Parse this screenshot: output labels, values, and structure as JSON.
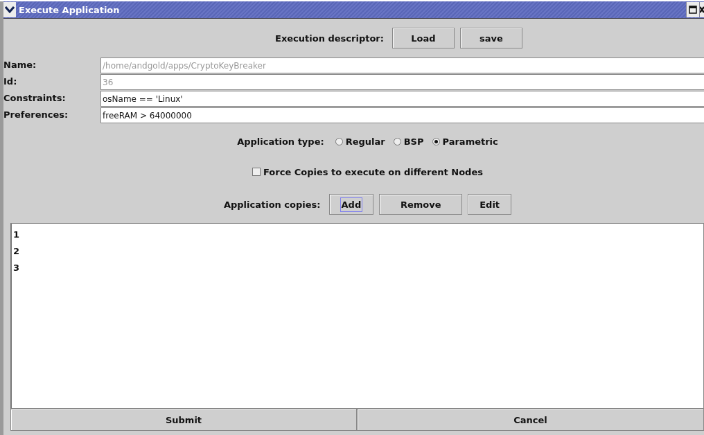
{
  "window": {
    "title": "Execute Application"
  },
  "descriptor": {
    "label": "Execution descriptor:",
    "buttons": [
      {
        "label": "Load"
      },
      {
        "label": "save"
      }
    ]
  },
  "fields": [
    {
      "label": "Name:",
      "value": "/home/andgold/apps/CryptoKeyBreaker",
      "disabled": true
    },
    {
      "label": "Id:",
      "value": "36",
      "disabled": true
    },
    {
      "label": "Constraints:",
      "value": "osName == 'Linux'",
      "disabled": false
    },
    {
      "label": "Preferences:",
      "value": "freeRAM > 64000000",
      "disabled": false
    }
  ],
  "application_type": {
    "label": "Application type:",
    "options": [
      {
        "label": "Regular",
        "selected": false
      },
      {
        "label": "BSP",
        "selected": false
      },
      {
        "label": "Parametric",
        "selected": true
      }
    ]
  },
  "force_copies": {
    "label": "Force Copies to execute on different Nodes",
    "checked": false
  },
  "copies": {
    "label": "Application copies:",
    "buttons": [
      {
        "label": "Add",
        "focused": true
      },
      {
        "label": "Remove",
        "focused": false
      },
      {
        "label": "Edit",
        "focused": false
      }
    ]
  },
  "copies_list": [
    "1",
    "2",
    "3"
  ],
  "actions": [
    {
      "label": "Submit"
    },
    {
      "label": "Cancel"
    }
  ]
}
